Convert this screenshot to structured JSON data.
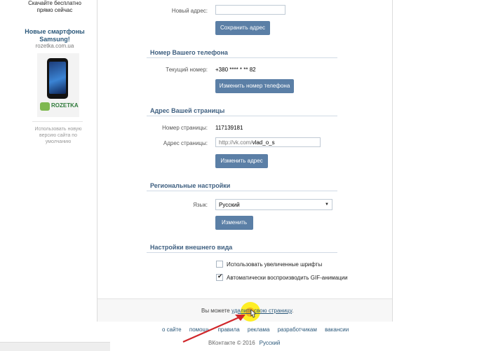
{
  "left_ad": {
    "top_text": "Скачайте бесплатно прямо сейчас",
    "title": "Новые смартфоны Samsung!",
    "domain": "rozetka.com.ua",
    "brand_logo": "ROZETKA",
    "mobile_link": "Использовать новую версию сайта по умолчанию"
  },
  "address_change": {
    "new_address_label": "Новый адрес:",
    "new_address_value": "",
    "save_button": "Сохранить адрес"
  },
  "phone_section": {
    "title": "Номер Вашего телефона",
    "current_label": "Текущий номер:",
    "current_value": "+380 **** * ** 82",
    "change_button": "Изменить номер телефона"
  },
  "page_address": {
    "title": "Адрес Вашей страницы",
    "page_number_label": "Номер страницы:",
    "page_number_value": "117139181",
    "address_label": "Адрес страницы:",
    "address_prefix": "http://vk.com/",
    "address_value": "vlad_o_s",
    "change_button": "Изменить адрес"
  },
  "regional": {
    "title": "Региональные настройки",
    "language_label": "Язык:",
    "language_selected": "Русский",
    "change_button": "Изменить"
  },
  "appearance": {
    "title": "Настройки внешнего вида",
    "large_fonts_label": "Использовать увеличенные шрифты",
    "large_fonts_checked": false,
    "gif_autoplay_label": "Автоматически воспроизводить GIF-анимации",
    "gif_autoplay_checked": true
  },
  "delete": {
    "prefix": "Вы можете",
    "link_text": "удалить свою страницу",
    "suffix": "."
  },
  "footer": {
    "links": [
      "о сайте",
      "помощь",
      "правила",
      "реклама",
      "разработчикам",
      "вакансии"
    ],
    "copyright": "ВКонтакте © 2016",
    "language": "Русский"
  },
  "colors": {
    "accent_button": "#5b7fa6",
    "link": "#2b587a",
    "highlight": "#ffec00",
    "arrow": "#d0262a"
  }
}
